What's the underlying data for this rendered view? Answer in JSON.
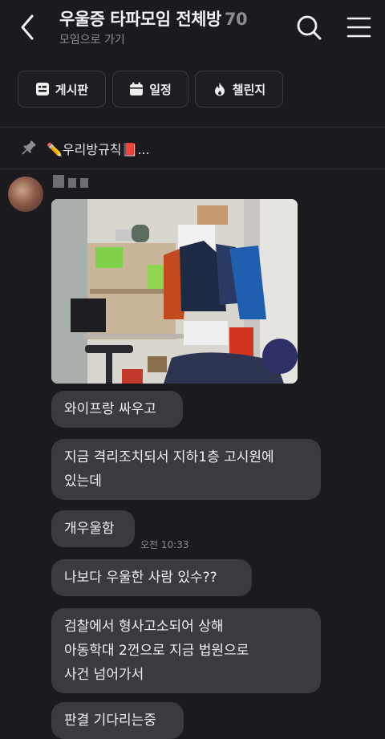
{
  "header": {
    "title": "우울증 타파모임 전체방",
    "member_count": "70",
    "subtitle": "모임으로 가기"
  },
  "tabs": [
    {
      "label": "게시판",
      "icon": "board-icon"
    },
    {
      "label": "일정",
      "icon": "calendar-icon"
    },
    {
      "label": "챌린지",
      "icon": "flame-icon"
    }
  ],
  "notice": {
    "icon": "pin-icon",
    "text": "✏️우리방규칙📕..."
  },
  "messages": [
    {
      "type": "image",
      "description_icon": "photo"
    },
    {
      "type": "text",
      "lines": [
        "와이프랑 싸우고"
      ]
    },
    {
      "type": "text",
      "lines": [
        "지금 격리조치되서 지하1층 고시원에",
        "있는데"
      ]
    },
    {
      "type": "text",
      "lines": [
        "개우울함"
      ],
      "time": "오전 10:33"
    },
    {
      "type": "text",
      "lines": [
        "나보다 우울한 사람 있수??"
      ]
    },
    {
      "type": "text",
      "lines": [
        "검찰에서 형사고소되어 상해",
        "아동학대 2껀으로 지금 법원으로",
        "사건 넘어가서"
      ]
    },
    {
      "type": "text",
      "lines": [
        "판결 기다리는중"
      ]
    }
  ]
}
